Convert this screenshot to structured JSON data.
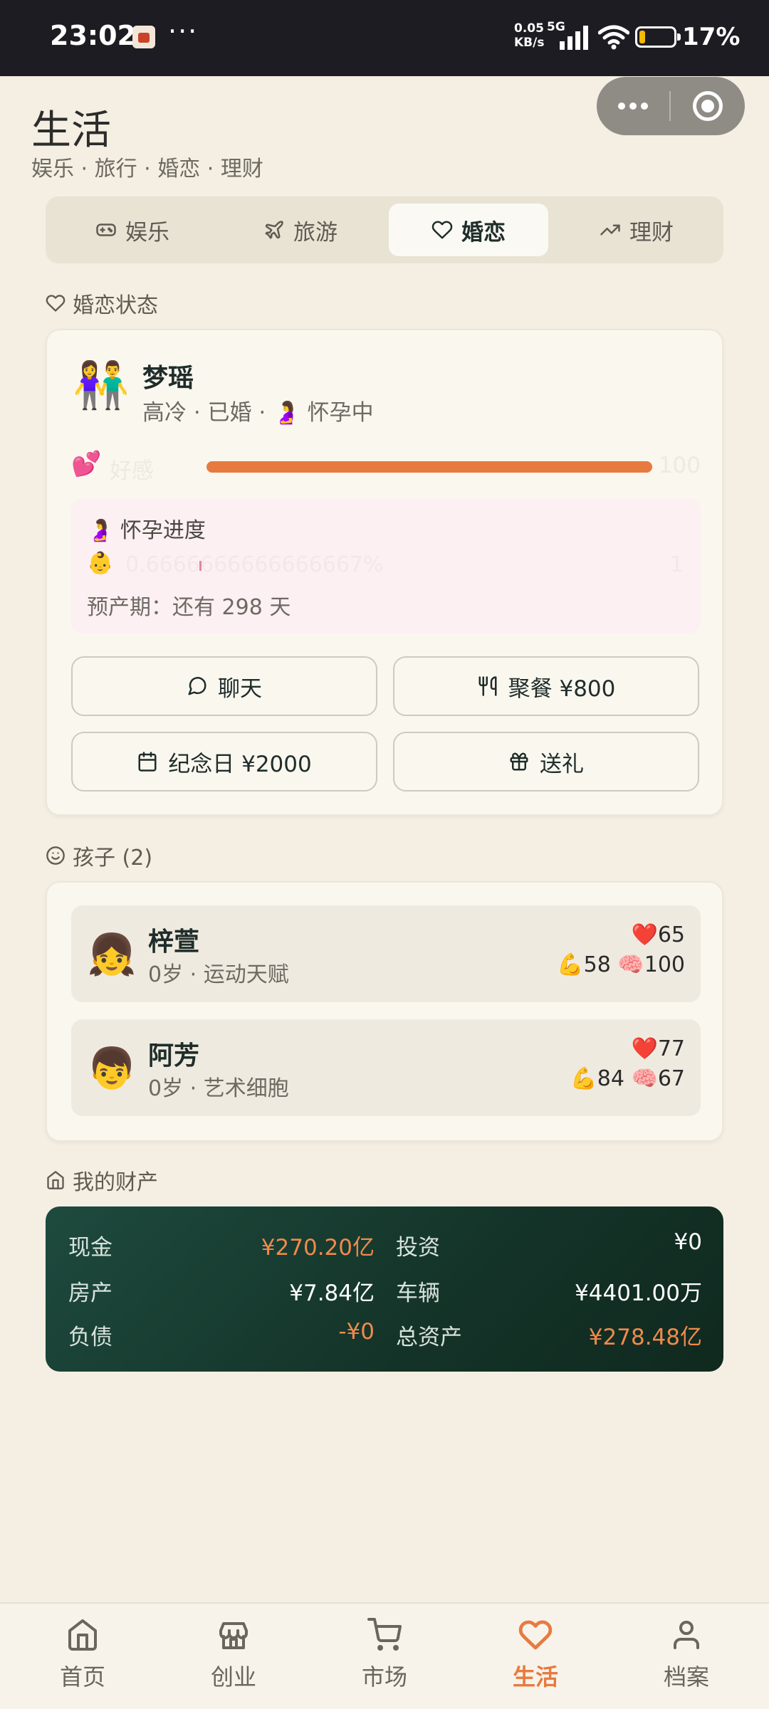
{
  "status": {
    "time": "23:02",
    "dots": "···",
    "net_speed": "0.05",
    "net_unit": "KB/s",
    "network": "5G",
    "battery": "17%"
  },
  "header": {
    "title": "生活",
    "subtitle": "娱乐 · 旅行 · 婚恋 · 理财"
  },
  "tabs": [
    {
      "label": "娱乐",
      "icon": "gamepad-icon"
    },
    {
      "label": "旅游",
      "icon": "plane-icon"
    },
    {
      "label": "婚恋",
      "icon": "heart-icon",
      "active": true
    },
    {
      "label": "理财",
      "icon": "trending-up-icon"
    }
  ],
  "marriage": {
    "section_label": "婚恋状态",
    "spouse": {
      "emoji": "👫",
      "name": "梦瑶",
      "meta": "高冷 · 已婚 · 🤰 怀孕中"
    },
    "favor": {
      "emoji": "💕",
      "label": "好感",
      "value": "100",
      "fraction": 1.0
    },
    "pregnancy": {
      "title": "🤰 怀孕进度",
      "emoji": "👶",
      "percent": "0.6666666666666667%",
      "value": "1",
      "due": "预产期：还有 298 天"
    },
    "actions": [
      {
        "label": "聊天",
        "icon": "chat-icon"
      },
      {
        "label": "聚餐 ¥800",
        "icon": "utensils-icon"
      },
      {
        "label": "纪念日 ¥2000",
        "icon": "calendar-icon"
      },
      {
        "label": "送礼",
        "icon": "gift-icon"
      }
    ]
  },
  "children": {
    "section_label": "孩子 (2)",
    "items": [
      {
        "emoji": "👧",
        "name": "梓萱",
        "meta": "0岁 · 运动天赋",
        "hp": "❤️65",
        "stats": "💪58 🧠100"
      },
      {
        "emoji": "👦",
        "name": "阿芳",
        "meta": "0岁 · 艺术细胞",
        "hp": "❤️77",
        "stats": "💪84 🧠67"
      }
    ]
  },
  "assets": {
    "section_label": "我的财产",
    "items": [
      {
        "label": "现金",
        "value": "¥270.20亿",
        "highlight": true
      },
      {
        "label": "投资",
        "value": "¥0",
        "highlight": false
      },
      {
        "label": "房产",
        "value": "¥7.84亿",
        "highlight": false
      },
      {
        "label": "车辆",
        "value": "¥4401.00万",
        "highlight": false
      },
      {
        "label": "负债",
        "value": "-¥0",
        "highlight": true
      },
      {
        "label": "总资产",
        "value": "¥278.48亿",
        "highlight": true
      }
    ]
  },
  "nav": [
    {
      "label": "首页",
      "icon": "home-icon"
    },
    {
      "label": "创业",
      "icon": "store-icon"
    },
    {
      "label": "市场",
      "icon": "cart-icon"
    },
    {
      "label": "生活",
      "icon": "heart-icon",
      "active": true
    },
    {
      "label": "档案",
      "icon": "user-icon"
    }
  ],
  "colors": {
    "accent": "#e77b3f",
    "background": "#f4efe2",
    "dark_green": "#143328"
  }
}
